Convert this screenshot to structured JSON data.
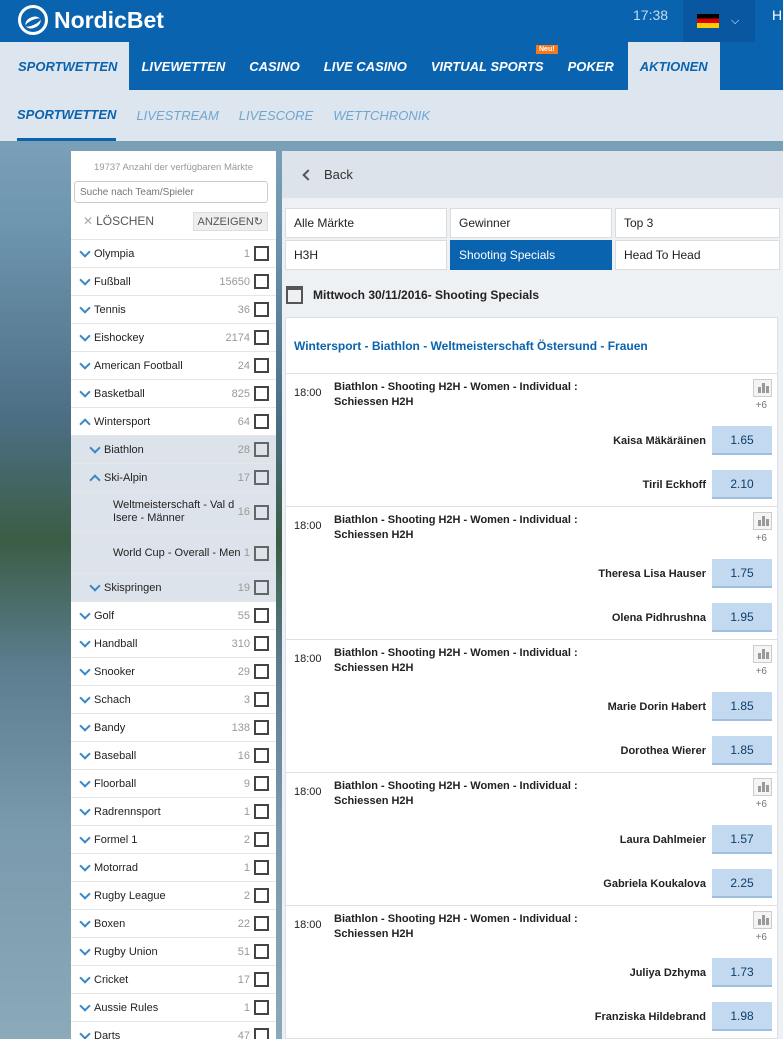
{
  "brand": {
    "name": "NordicBet"
  },
  "header": {
    "time": "17:38",
    "right_link": "H"
  },
  "main_nav": [
    {
      "label": "SPORTWETTEN"
    },
    {
      "label": "LIVEWETTEN"
    },
    {
      "label": "CASINO"
    },
    {
      "label": "LIVE CASINO"
    },
    {
      "label": "VIRTUAL SPORTS",
      "badge": "Neu!"
    },
    {
      "label": "POKER"
    },
    {
      "label": "AKTIONEN"
    }
  ],
  "sub_nav": [
    {
      "label": "SPORTWETTEN"
    },
    {
      "label": "LIVESTREAM"
    },
    {
      "label": "LIVESCORE"
    },
    {
      "label": "WETTCHRONIK"
    }
  ],
  "sidebar": {
    "count_text": "19737 Anzahl der verfügbaren Märkte",
    "search_placeholder": "Suche nach Team/Spieler",
    "clear_label": "LÖSCHEN",
    "show_label": "ANZEIGEN",
    "items": [
      {
        "name": "Olympia",
        "count": "1"
      },
      {
        "name": "Fußball",
        "count": "15650"
      },
      {
        "name": "Tennis",
        "count": "36"
      },
      {
        "name": "Eishockey",
        "count": "2174"
      },
      {
        "name": "American Football",
        "count": "24"
      },
      {
        "name": "Basketball",
        "count": "825"
      },
      {
        "name": "Wintersport",
        "count": "64"
      },
      {
        "name": "Biathlon",
        "count": "28"
      },
      {
        "name": "Ski-Alpin",
        "count": "17"
      },
      {
        "name": "Weltmeisterschaft - Val d Isere - Männer",
        "count": "16"
      },
      {
        "name": "World Cup - Overall - Men",
        "count": "1"
      },
      {
        "name": "Skispringen",
        "count": "19"
      },
      {
        "name": "Golf",
        "count": "55"
      },
      {
        "name": "Handball",
        "count": "310"
      },
      {
        "name": "Snooker",
        "count": "29"
      },
      {
        "name": "Schach",
        "count": "3"
      },
      {
        "name": "Bandy",
        "count": "138"
      },
      {
        "name": "Baseball",
        "count": "16"
      },
      {
        "name": "Floorball",
        "count": "9"
      },
      {
        "name": "Radrennsport",
        "count": "1"
      },
      {
        "name": "Formel 1",
        "count": "2"
      },
      {
        "name": "Motorrad",
        "count": "1"
      },
      {
        "name": "Rugby League",
        "count": "2"
      },
      {
        "name": "Boxen",
        "count": "22"
      },
      {
        "name": "Rugby Union",
        "count": "51"
      },
      {
        "name": "Cricket",
        "count": "17"
      },
      {
        "name": "Aussie Rules",
        "count": "1"
      },
      {
        "name": "Darts",
        "count": "47"
      }
    ]
  },
  "content": {
    "back_label": "Back",
    "tabs": [
      {
        "label": "Alle Märkte"
      },
      {
        "label": "Gewinner"
      },
      {
        "label": "Top 3"
      },
      {
        "label": "H3H"
      },
      {
        "label": "Shooting Specials"
      },
      {
        "label": "Head To Head"
      }
    ],
    "date_heading": "Mittwoch 30/11/2016- Shooting Specials",
    "event_title": "Wintersport - Biathlon - Weltmeisterschaft Östersund - Frauen",
    "matches": [
      {
        "time": "18:00",
        "title": "Biathlon - Shooting H2H - Women - Individual : Schiessen H2H",
        "more": "+6",
        "p1": "Kaisa Mäkäräinen",
        "o1": "1.65",
        "p2": "Tiril Eckhoff",
        "o2": "2.10"
      },
      {
        "time": "18:00",
        "title": "Biathlon - Shooting H2H - Women - Individual : Schiessen H2H",
        "more": "+6",
        "p1": "Theresa Lisa Hauser",
        "o1": "1.75",
        "p2": "Olena Pidhrushna",
        "o2": "1.95"
      },
      {
        "time": "18:00",
        "title": "Biathlon - Shooting H2H - Women - Individual : Schiessen H2H",
        "more": "+6",
        "p1": "Marie Dorin Habert",
        "o1": "1.85",
        "p2": "Dorothea Wierer",
        "o2": "1.85"
      },
      {
        "time": "18:00",
        "title": "Biathlon - Shooting H2H - Women - Individual : Schiessen H2H",
        "more": "+6",
        "p1": "Laura Dahlmeier",
        "o1": "1.57",
        "p2": "Gabriela Koukalova",
        "o2": "2.25"
      },
      {
        "time": "18:00",
        "title": "Biathlon - Shooting H2H - Women - Individual : Schiessen H2H",
        "more": "+6",
        "p1": "Juliya Dzhyma",
        "o1": "1.73",
        "p2": "Franziska Hildebrand",
        "o2": "1.98"
      }
    ]
  }
}
